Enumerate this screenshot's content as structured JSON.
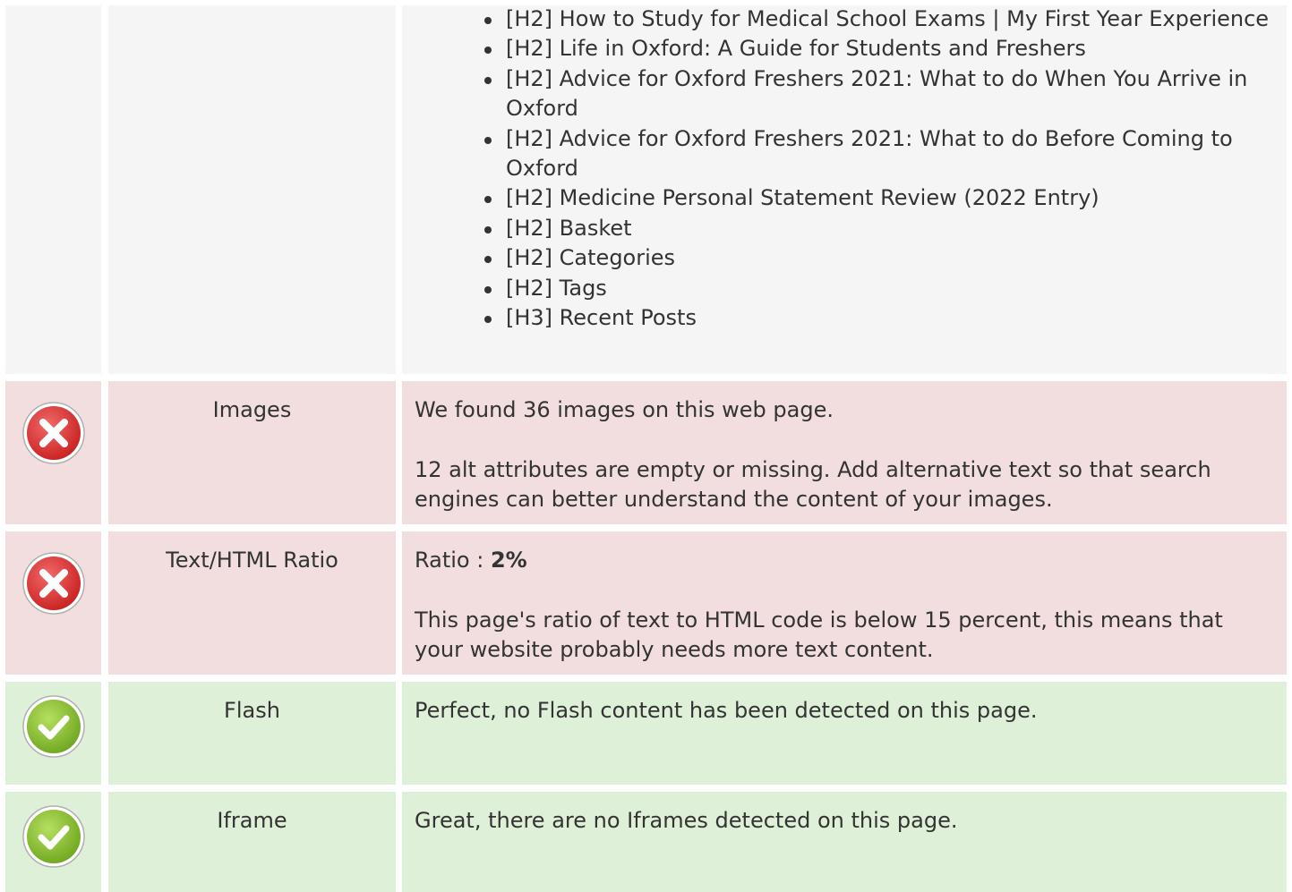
{
  "headings_list": [
    "[H2] How to Study for Medical School Exams | My First Year Experience",
    "[H2] Life in Oxford: A Guide for Students and Freshers",
    "[H2] Advice for Oxford Freshers 2021: What to do When You Arrive in Oxford",
    "[H2] Advice for Oxford Freshers 2021: What to do Before Coming to Oxford",
    "[H2] Medicine Personal Statement Review (2022 Entry)",
    "[H2] Basket",
    "[H2] Categories",
    "[H2] Tags",
    "[H3] Recent Posts"
  ],
  "rows": {
    "images": {
      "status": "error",
      "status_icon": "error-x-icon",
      "label": "Images",
      "text1": "We found 36 images on this web page.",
      "text2": "12 alt attributes are empty or missing. Add alternative text so that search engines can better understand the content of your images."
    },
    "ratio": {
      "status": "error",
      "status_icon": "error-x-icon",
      "label": "Text/HTML Ratio",
      "ratio_prefix": "Ratio : ",
      "ratio_value": "2%",
      "text2": "This page's ratio of text to HTML code is below 15 percent, this means that your website probably needs more text content."
    },
    "flash": {
      "status": "success",
      "status_icon": "check-icon",
      "label": "Flash",
      "text1": "Perfect, no Flash content has been detected on this page."
    },
    "iframe": {
      "status": "success",
      "status_icon": "check-icon",
      "label": "Iframe",
      "text1": "Great, there are no Iframes detected on this page."
    }
  },
  "colors": {
    "error_bg": "#f2dede",
    "success_bg": "#dff0d8",
    "neutral_bg": "#f5f5f5",
    "error_icon": "#e03a3a",
    "success_icon": "#8cc43c"
  }
}
